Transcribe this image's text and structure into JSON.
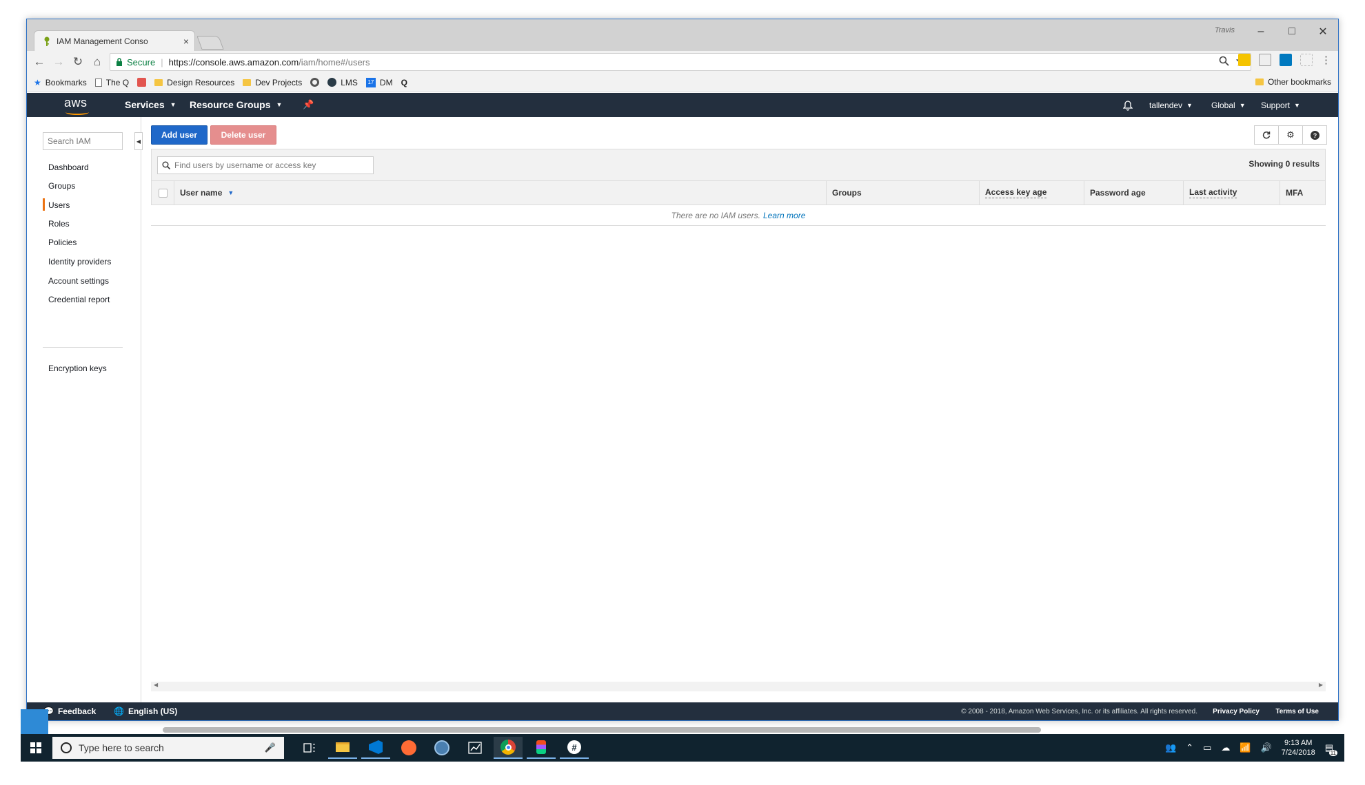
{
  "browser": {
    "tab_title": "IAM Management Conso",
    "tab_close": "×",
    "profile_name": "Travis",
    "window_controls": {
      "minimize": "–",
      "maximize": "□",
      "close": "✕"
    },
    "nav": {
      "back": "←",
      "forward": "→",
      "reload": "↻",
      "home": "⌂"
    },
    "secure_label": "Secure",
    "url_main": "https://console.aws.amazon.com",
    "url_path": "/iam/home#/users",
    "bookmarks": [
      {
        "label": "Bookmarks",
        "icon": "star-icon"
      },
      {
        "label": "The Q",
        "icon": "page-icon"
      },
      {
        "label": "",
        "icon": "app-icon"
      },
      {
        "label": "Design Resources",
        "icon": "folder-icon"
      },
      {
        "label": "Dev Projects",
        "icon": "folder-icon"
      },
      {
        "label": "",
        "icon": "chrome-circle-icon"
      },
      {
        "label": "LMS",
        "icon": "dark-circle-icon"
      },
      {
        "label": "DM",
        "icon": "calendar-icon"
      },
      {
        "label": "",
        "icon": "q-icon"
      }
    ],
    "other_bookmarks": "Other bookmarks",
    "calendar_day": "17"
  },
  "aws_nav": {
    "logo_text": "aws",
    "services": "Services",
    "resource_groups": "Resource Groups",
    "user": "tallendev",
    "region": "Global",
    "support": "Support"
  },
  "sidebar": {
    "search_placeholder": "Search IAM",
    "collapse": "◀",
    "items": [
      {
        "label": "Dashboard"
      },
      {
        "label": "Groups"
      },
      {
        "label": "Users",
        "active": true
      },
      {
        "label": "Roles"
      },
      {
        "label": "Policies"
      },
      {
        "label": "Identity providers"
      },
      {
        "label": "Account settings"
      },
      {
        "label": "Credential report"
      }
    ],
    "encryption_keys": "Encryption keys"
  },
  "main": {
    "add_user": "Add user",
    "delete_user": "Delete user",
    "filter_placeholder": "Find users by username or access key",
    "results": "Showing 0 results",
    "columns": {
      "user_name": "User name",
      "groups": "Groups",
      "access_key_age": "Access key age",
      "password_age": "Password age",
      "last_activity": "Last activity",
      "mfa": "MFA"
    },
    "empty_text": "There are no IAM users.",
    "learn_more": "Learn more"
  },
  "footer": {
    "feedback": "Feedback",
    "language": "English (US)",
    "copyright": "© 2008 - 2018, Amazon Web Services, Inc. or its affiliates. All rights reserved.",
    "privacy": "Privacy Policy",
    "terms": "Terms of Use"
  },
  "taskbar": {
    "search_placeholder": "Type here to search",
    "time": "9:13 AM",
    "date": "7/24/2018",
    "notification_count": "11"
  },
  "colors": {
    "aws_nav": "#232f3e",
    "primary_button": "#1f68c9",
    "danger_button": "#e58e8e",
    "active_accent": "#ec7211",
    "link": "#0073bb",
    "taskbar": "#10232f"
  }
}
